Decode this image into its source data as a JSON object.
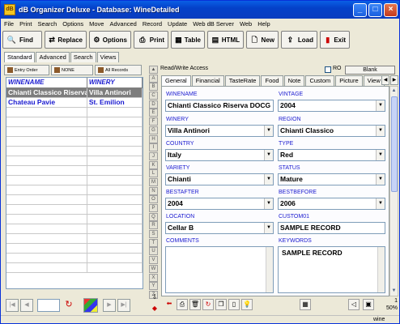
{
  "window": {
    "title": "dB Organizer Deluxe - Database: WineDetailed",
    "icon_letter": "dB"
  },
  "menu": [
    "File",
    "Print",
    "Search",
    "Options",
    "Move",
    "Advanced",
    "Record",
    "Update",
    "Web dB Server",
    "Web",
    "Help"
  ],
  "toolbar": {
    "find": "Find",
    "replace": "Replace",
    "options": "Options",
    "print": "Print",
    "table": "Table",
    "html": "HTML",
    "new": "New",
    "load": "Load",
    "exit": "Exit"
  },
  "left_tabs": [
    "Standard",
    "Advanced",
    "Search",
    "Views"
  ],
  "order_buttons": [
    "Entry Order",
    "NONE",
    "All Records"
  ],
  "grid": {
    "columns": [
      "WINENAME",
      "WINERY"
    ],
    "rows": [
      [
        "Chianti Classico Riserva DOCG",
        "Villa Antinori"
      ],
      [
        "Chateau Pavie",
        "St. Emilion"
      ]
    ]
  },
  "alpha": [
    "A",
    "B",
    "C",
    "D",
    "E",
    "F",
    "G",
    "H",
    "I",
    "J",
    "K",
    "L",
    "M",
    "N",
    "O",
    "P",
    "Q",
    "R",
    "S",
    "T",
    "U",
    "V",
    "W",
    "X",
    "Y",
    "Z"
  ],
  "access": {
    "label": "Read/Write Access",
    "ro": "RO",
    "blank": "Blank"
  },
  "right_tabs": [
    "General",
    "Financial",
    "TasteRate",
    "Food",
    "Note",
    "Custom",
    "Picture",
    "View"
  ],
  "fields": {
    "winename_label": "WINENAME",
    "winename": "Chianti Classico Riserva DOCG",
    "vintage_label": "VINTAGE",
    "vintage": "2004",
    "winery_label": "WINERY",
    "winery": "Villa Antinori",
    "region_label": "REGION",
    "region": "Chianti Classico",
    "country_label": "COUNTRY",
    "country": "Italy",
    "type_label": "TYPE",
    "type": "Red",
    "variety_label": "VARIETY",
    "variety": "Chianti",
    "status_label": "STATUS",
    "status": "Mature",
    "bestafter_label": "BESTAFTER",
    "bestafter": "2004",
    "bestbefore_label": "BESTBEFORE",
    "bestbefore": "2006",
    "location_label": "LOCATION",
    "location": "Cellar B",
    "custom01_label": "CUSTOM01",
    "custom01": "SAMPLE RECORD",
    "comments_label": "COMMENTS",
    "comments": "",
    "keywords_label": "KEYWORDS",
    "keywords": "SAMPLE RECORD"
  },
  "zoom": {
    "count": "1",
    "percent": "50%"
  },
  "status": {
    "text": "wine"
  }
}
